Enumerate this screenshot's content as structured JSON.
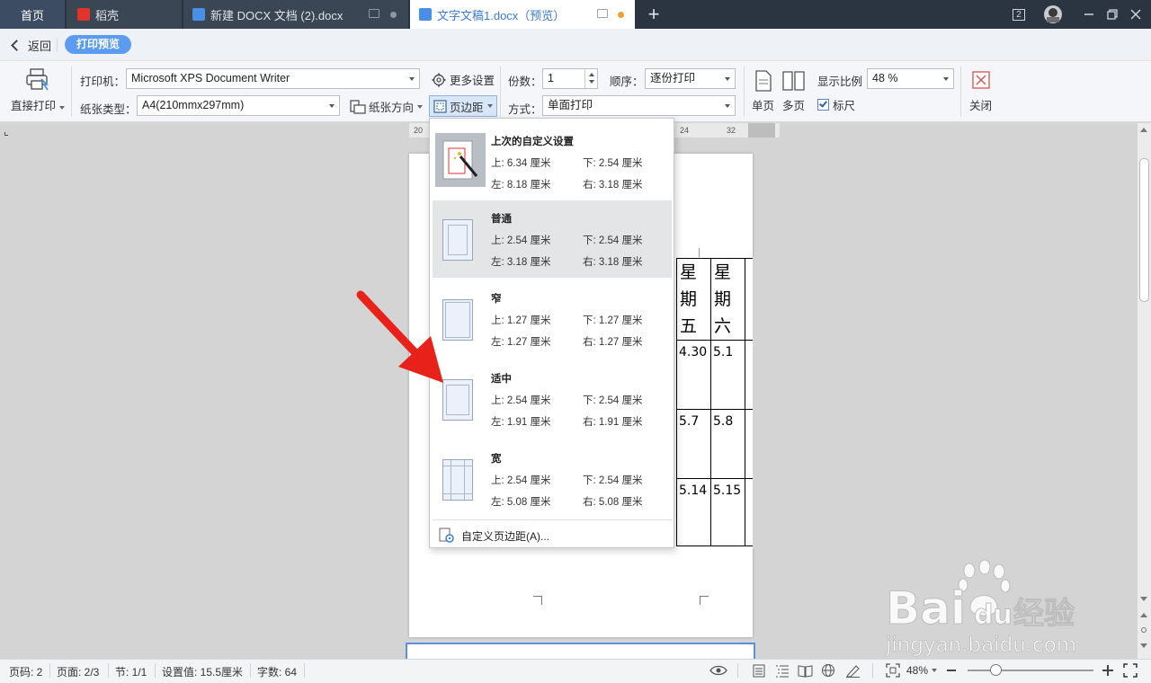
{
  "tabs": {
    "home": "首页",
    "daoke": "稻壳",
    "doc1": "新建 DOCX 文档 (2).docx",
    "doc2": "文字文稿1.docx（预览）",
    "window_badge": "2"
  },
  "header": {
    "back": "返回",
    "mode": "打印预览"
  },
  "toolbar": {
    "direct_print": "直接打印",
    "printer_label": "打印机：",
    "printer_value": "Microsoft XPS Document Writer",
    "more_settings": "更多设置",
    "copies_label": "份数：",
    "copies_value": "1",
    "order_label": "顺序：",
    "order_value": "逐份打印",
    "paper_label": "纸张类型：",
    "paper_value": "A4(210mmx297mm)",
    "orientation": "纸张方向",
    "margins": "页边距",
    "method_label": "方式：",
    "method_value": "单面打印",
    "single_page": "单页",
    "multi_page": "多页",
    "zoom_label": "显示比例",
    "zoom_value": "48 %",
    "ruler": "标尺",
    "close": "关闭"
  },
  "ruler_numbers": [
    "20",
    "24",
    "32"
  ],
  "margin_presets": [
    {
      "name": "上次的自定义设置",
      "top": "上: 6.34 厘米",
      "bottom": "下: 2.54 厘米",
      "left": "左: 8.18 厘米",
      "right": "右: 3.18 厘米"
    },
    {
      "name": "普通",
      "top": "上: 2.54 厘米",
      "bottom": "下: 2.54 厘米",
      "left": "左: 3.18 厘米",
      "right": "右: 3.18 厘米"
    },
    {
      "name": "窄",
      "top": "上: 1.27 厘米",
      "bottom": "下: 1.27 厘米",
      "left": "左: 1.27 厘米",
      "right": "右: 1.27 厘米"
    },
    {
      "name": "适中",
      "top": "上: 2.54 厘米",
      "bottom": "下: 2.54 厘米",
      "left": "左: 1.91 厘米",
      "right": "右: 1.91 厘米"
    },
    {
      "name": "宽",
      "top": "上: 2.54 厘米",
      "bottom": "下: 2.54 厘米",
      "left": "左: 5.08 厘米",
      "right": "右: 5.08 厘米"
    }
  ],
  "custom_margins": "自定义页边距(A)...",
  "table": {
    "headers": [
      "星期五",
      "星期六"
    ],
    "rows": [
      [
        "4.30",
        "5.1"
      ],
      [
        "5.7",
        "5.8"
      ],
      [
        "5.14",
        "5.15"
      ]
    ]
  },
  "status": {
    "page_code": "页码: 2",
    "page": "页面: 2/3",
    "section": "节: 1/1",
    "setting": "设置值: 15.5厘米",
    "words": "字数: 64",
    "zoom": "48%"
  },
  "watermark": {
    "text": "jingyan.baidu.com"
  },
  "colors": {
    "accent": "#5b9cf0",
    "annotation_arrow": "#e8221b",
    "tabbar": "#2b3541"
  }
}
